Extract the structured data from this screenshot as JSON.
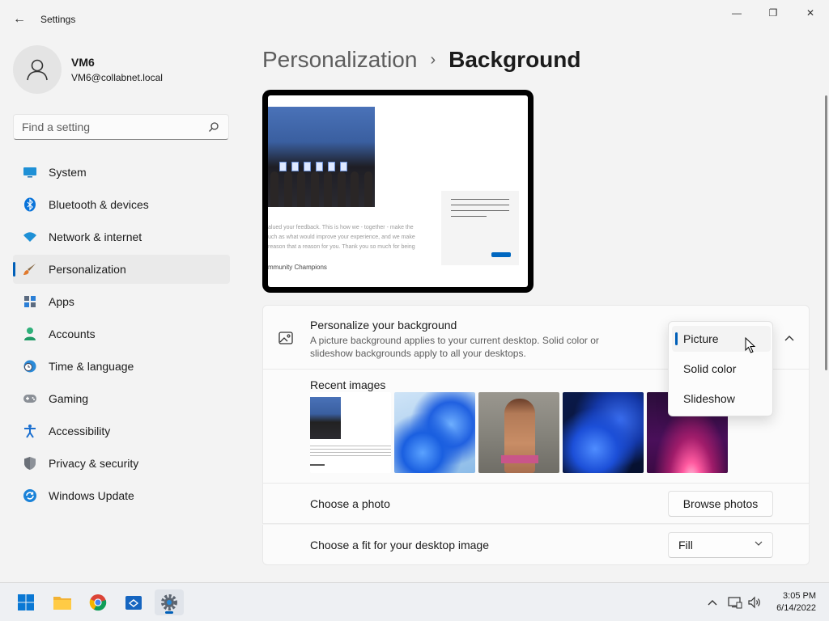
{
  "window": {
    "title": "Settings",
    "back_glyph": "←",
    "minimize_glyph": "—",
    "maximize_glyph": "❐",
    "close_glyph": "✕"
  },
  "user": {
    "name": "VM6",
    "email": "VM6@collabnet.local"
  },
  "search": {
    "placeholder": "Find a setting"
  },
  "sidebar": {
    "items": [
      {
        "label": "System",
        "icon": "monitor-icon"
      },
      {
        "label": "Bluetooth & devices",
        "icon": "bluetooth-icon"
      },
      {
        "label": "Network & internet",
        "icon": "wifi-icon"
      },
      {
        "label": "Personalization",
        "icon": "brush-icon",
        "active": true
      },
      {
        "label": "Apps",
        "icon": "apps-icon"
      },
      {
        "label": "Accounts",
        "icon": "person-icon"
      },
      {
        "label": "Time & language",
        "icon": "clock-globe-icon"
      },
      {
        "label": "Gaming",
        "icon": "gamepad-icon"
      },
      {
        "label": "Accessibility",
        "icon": "accessibility-icon"
      },
      {
        "label": "Privacy & security",
        "icon": "shield-icon"
      },
      {
        "label": "Windows Update",
        "icon": "update-icon"
      }
    ]
  },
  "breadcrumb": {
    "parent": "Personalization",
    "separator": "›",
    "current": "Background"
  },
  "preview": {
    "caption": "mmunity Champions",
    "text_lines": [
      "alued your feedback. This is how we - together - make the",
      "uch as what would improve your experience, and we make",
      "reason that a reason for you. Thank you so much for being"
    ]
  },
  "background_setting": {
    "title": "Personalize your background",
    "description": "A picture background applies to your current desktop. Solid color or slideshow backgrounds apply to all your desktops.",
    "icon": "image-icon",
    "dropdown": {
      "options": [
        "Picture",
        "Solid color",
        "Slideshow"
      ],
      "selected": "Picture"
    }
  },
  "recent_images": {
    "label": "Recent images"
  },
  "choose_photo": {
    "label": "Choose a photo",
    "button": "Browse photos"
  },
  "fit": {
    "label": "Choose a fit for your desktop image",
    "value": "Fill"
  },
  "taskbar": {
    "apps": [
      "start-icon",
      "file-explorer-icon",
      "chrome-icon",
      "app-icon",
      "settings-icon"
    ],
    "tray": [
      "chevron-up-icon",
      "network-icon",
      "volume-icon"
    ],
    "time": "3:05 PM",
    "date": "6/14/2022"
  },
  "colors": {
    "accent": "#005fb8",
    "background": "#f3f3f3",
    "card": "#fbfbfb"
  }
}
